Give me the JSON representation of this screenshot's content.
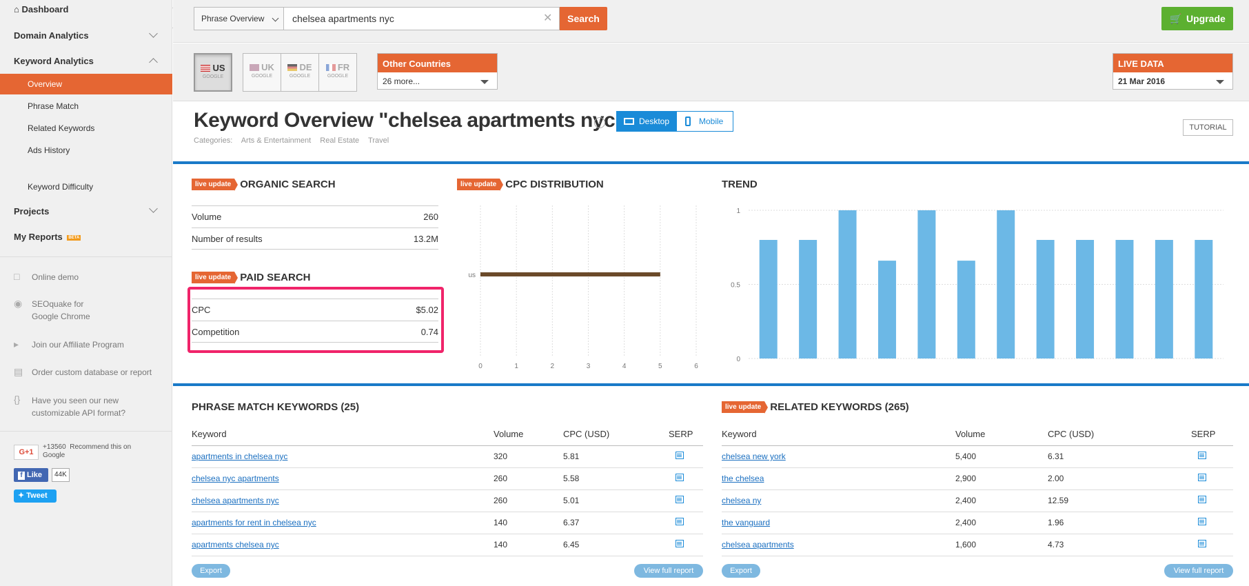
{
  "sidebar": {
    "dashboard": "Dashboard",
    "domain_analytics": "Domain Analytics",
    "keyword_analytics": "Keyword Analytics",
    "sub_items": [
      "Overview",
      "Phrase Match",
      "Related Keywords",
      "Ads History"
    ],
    "keyword_difficulty": "Keyword Difficulty",
    "projects": "Projects",
    "my_reports": "My Reports",
    "beta": "BETA",
    "links": {
      "online_demo": "Online demo",
      "seoquake_1": "SEOquake for",
      "seoquake_2": "Google Chrome",
      "affiliate": "Join our Affiliate Program",
      "order_db": "Order custom database or report",
      "api_1": "Have you seen our new",
      "api_2": "customizable API format?"
    },
    "social": {
      "gplus": "G+1",
      "gplus_count": "+13560",
      "recommend_1": "Recommend this on",
      "recommend_2": "Google",
      "like": "Like",
      "like_count": "44K",
      "tweet": "Tweet"
    }
  },
  "search": {
    "mode": "Phrase Overview",
    "query": "chelsea apartments nyc",
    "button": "Search"
  },
  "upgrade": "Upgrade",
  "databases": [
    {
      "code": "US",
      "engine": "GOOGLE"
    },
    {
      "code": "UK",
      "engine": "GOOGLE"
    },
    {
      "code": "DE",
      "engine": "GOOGLE"
    },
    {
      "code": "FR",
      "engine": "GOOGLE"
    }
  ],
  "other_countries": {
    "label": "Other Countries",
    "value": "26 more..."
  },
  "live_data": {
    "label": "LIVE DATA",
    "value": "21 Mar 2016"
  },
  "page": {
    "title": "Keyword Overview \"chelsea apartments nyc\"",
    "categories_label": "Categories:",
    "categories": [
      "Arts & Entertainment",
      "Real Estate",
      "Travel"
    ],
    "desktop": "Desktop",
    "mobile": "Mobile",
    "tutorial": "TUTORIAL"
  },
  "live_update": "live update",
  "organic": {
    "title": "ORGANIC SEARCH",
    "rows": [
      {
        "label": "Volume",
        "value": "260"
      },
      {
        "label": "Number of results",
        "value": "13.2M"
      }
    ]
  },
  "paid": {
    "title": "PAID SEARCH",
    "rows": [
      {
        "label": "CPC",
        "value": "$5.02"
      },
      {
        "label": "Competition",
        "value": "0.74"
      }
    ]
  },
  "cpc_title": "CPC DISTRIBUTION",
  "trend_title": "TREND",
  "chart_data": [
    {
      "type": "bar",
      "title": "CPC DISTRIBUTION",
      "categories": [
        "us"
      ],
      "values": [
        5
      ],
      "xticks": [
        "0",
        "1",
        "2",
        "3",
        "4",
        "5",
        "6"
      ],
      "xlim": [
        0,
        6
      ],
      "color": "#6b4a2a"
    },
    {
      "type": "bar",
      "title": "TREND",
      "values": [
        0.8,
        0.8,
        1.0,
        0.66,
        1.0,
        0.66,
        1.0,
        0.8,
        0.8,
        0.8,
        0.8,
        0.8
      ],
      "yticks": [
        "0",
        "0.5",
        "1"
      ],
      "ylim": [
        0,
        1
      ],
      "color": "#6cb8e6"
    }
  ],
  "phrase_match": {
    "title": "PHRASE MATCH KEYWORDS (25)",
    "headers": [
      "Keyword",
      "Volume",
      "CPC (USD)",
      "SERP"
    ],
    "rows": [
      {
        "kw": "apartments in chelsea nyc",
        "vol": "320",
        "cpc": "5.81"
      },
      {
        "kw": "chelsea nyc apartments",
        "vol": "260",
        "cpc": "5.58"
      },
      {
        "kw": "chelsea apartments nyc",
        "vol": "260",
        "cpc": "5.01"
      },
      {
        "kw": "apartments for rent in chelsea nyc",
        "vol": "140",
        "cpc": "6.37"
      },
      {
        "kw": "apartments chelsea nyc",
        "vol": "140",
        "cpc": "6.45"
      }
    ],
    "export": "Export",
    "full_report": "View full report"
  },
  "related": {
    "title": "RELATED KEYWORDS (265)",
    "headers": [
      "Keyword",
      "Volume",
      "CPC (USD)",
      "SERP"
    ],
    "rows": [
      {
        "kw": "chelsea new york",
        "vol": "5,400",
        "cpc": "6.31"
      },
      {
        "kw": "the chelsea",
        "vol": "2,900",
        "cpc": "2.00"
      },
      {
        "kw": "chelsea ny",
        "vol": "2,400",
        "cpc": "12.59"
      },
      {
        "kw": "the vanguard",
        "vol": "2,400",
        "cpc": "1.96"
      },
      {
        "kw": "chelsea apartments",
        "vol": "1,600",
        "cpc": "4.73"
      }
    ],
    "export": "Export",
    "full_report": "View full report"
  }
}
